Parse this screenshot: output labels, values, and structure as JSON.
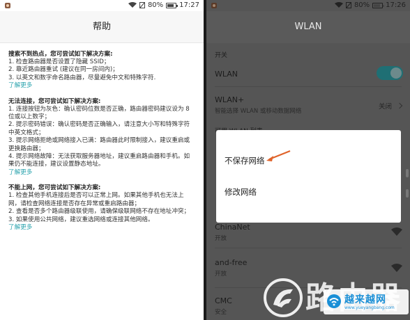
{
  "left": {
    "status": {
      "battery": "80%",
      "time": "17:27"
    },
    "title": "帮助",
    "sections": [
      {
        "heading": "搜索不到热点，您可尝试如下解决方案:",
        "lines": [
          "1. 检查路由器是否设置了隐藏 SSID；",
          "2. 靠近路由器重试 (建议在同一房间内)；",
          "3. 以英文和数字命名路由器，尽量避免中文和特殊字符."
        ],
        "more": "了解更多"
      },
      {
        "heading": "无法连接，您可尝试如下解决方案:",
        "lines": [
          "1. 连接按钮为灰色：确认密码位数是否正确，路由器密码建议设为 8 位或以上数字；",
          "2. 提示密码错误：确认密码是否正确输入，请注意大小写和特殊字符中英文格式；",
          "3. 提示网络拒绝或网络接入已满：路由器此时限制接入，建议重启或更换路由器；",
          "4. 提示网络故障：无法获取服务器地址，建议重启路由器和手机。如果仍不能连接，建议设置静态地址。"
        ],
        "more": "了解更多"
      },
      {
        "heading": "不能上网，您可尝试如下解决方案:",
        "lines": [
          "1. 检查其他手机连接后是否可以正常上网。如果其他手机也无法上网，请检查网络连接是否存在异常或重启路由器；",
          "2. 查看是否多个路由器级联使用，请确保级联网络不存在地址冲突；",
          "3. 如果使用公共网络，建议重选网络或连接其他网络。"
        ],
        "more": "了解更多"
      }
    ]
  },
  "right": {
    "status": {
      "battery": "80%",
      "time": "17:26"
    },
    "title": "WLAN",
    "switch_section": "开关",
    "wlan_label": "WLAN",
    "wlan_plus": {
      "label": "WLAN+",
      "sub": "智能选择 WLAN 或移动数据网络",
      "value": "关闭"
    },
    "available_label": "可用 WLAN 列表",
    "dialog": {
      "items": [
        "不保存网络",
        "修改网络"
      ]
    },
    "networks": [
      {
        "name": "ChinaNet",
        "sub": "开放"
      },
      {
        "name": "and-free",
        "sub": "开放"
      },
      {
        "name": "CMC",
        "sub": "安全"
      }
    ]
  },
  "watermark": {
    "text": "路由器",
    "badge_title": "越来越网",
    "badge_url": "www.yueyangbang.com"
  }
}
